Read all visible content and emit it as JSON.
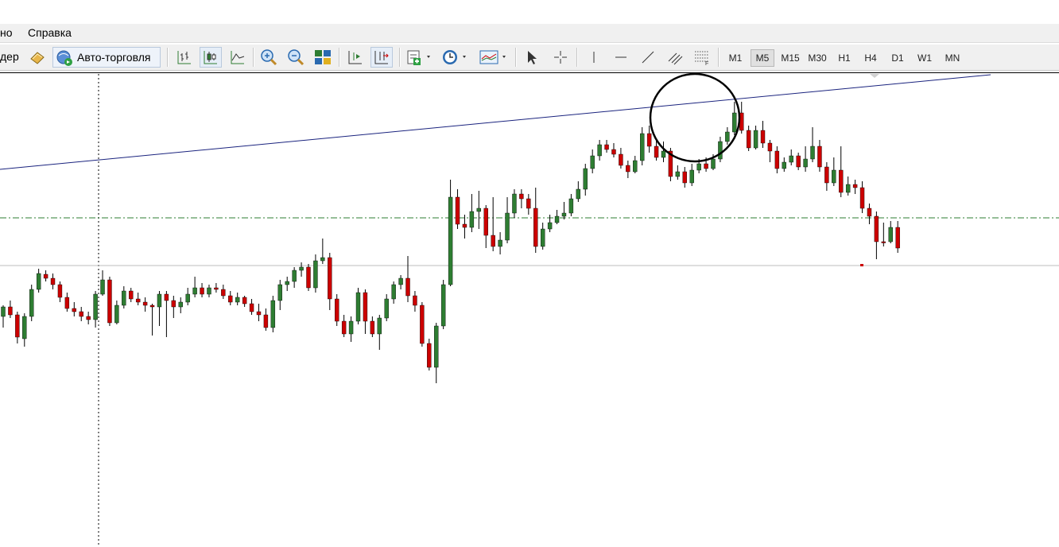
{
  "menu": {
    "item_partial": "но",
    "help": "Справка"
  },
  "toolbar": {
    "partial_label": "дер",
    "auto_trading_label": "Авто-торговля",
    "timeframes": [
      "M1",
      "M5",
      "M15",
      "M30",
      "H1",
      "H4",
      "D1",
      "W1",
      "MN"
    ],
    "active_timeframe": "M5",
    "icons": [
      "bar-chart-icon",
      "candlestick-chart-icon",
      "line-chart-icon",
      "zoom-in-icon",
      "zoom-out-icon",
      "tile-windows-icon",
      "chart-shift-icon",
      "autoscroll-icon",
      "indicators-icon",
      "periods-clock-icon",
      "templates-icon",
      "cursor-icon",
      "crosshair-icon",
      "vertical-line-icon",
      "horizontal-line-icon",
      "trendline-icon",
      "channel-icon",
      "fibonacci-icon"
    ]
  },
  "chart_data": {
    "type": "candlestick",
    "bullish_color": "#2e7d32",
    "bearish_color": "#cc0000",
    "candles": [
      [
        398,
        386,
        412,
        384
      ],
      [
        386,
        396,
        400,
        378
      ],
      [
        396,
        424,
        432,
        392
      ],
      [
        426,
        398,
        436,
        394
      ],
      [
        398,
        364,
        404,
        358
      ],
      [
        364,
        344,
        368,
        338
      ],
      [
        345,
        350,
        354,
        340
      ],
      [
        350,
        358,
        364,
        344
      ],
      [
        358,
        374,
        380,
        354
      ],
      [
        374,
        388,
        392,
        368
      ],
      [
        388,
        392,
        398,
        380
      ],
      [
        392,
        398,
        404,
        386
      ],
      [
        398,
        402,
        408,
        392
      ],
      [
        402,
        370,
        412,
        366
      ],
      [
        370,
        352,
        372,
        340
      ],
      [
        352,
        406,
        410,
        348
      ],
      [
        406,
        384,
        408,
        378
      ],
      [
        384,
        366,
        388,
        360
      ],
      [
        366,
        376,
        380,
        362
      ],
      [
        376,
        380,
        384,
        368
      ],
      [
        380,
        384,
        392,
        374
      ],
      [
        384,
        386,
        422,
        382
      ],
      [
        386,
        370,
        410,
        366
      ],
      [
        370,
        378,
        424,
        366
      ],
      [
        378,
        386,
        400,
        372
      ],
      [
        386,
        380,
        394,
        374
      ],
      [
        380,
        370,
        384,
        362
      ],
      [
        370,
        362,
        374,
        348
      ],
      [
        362,
        370,
        374,
        356
      ],
      [
        370,
        362,
        374,
        358
      ],
      [
        362,
        364,
        368,
        356
      ],
      [
        364,
        372,
        376,
        358
      ],
      [
        372,
        380,
        384,
        366
      ],
      [
        380,
        374,
        384,
        368
      ],
      [
        374,
        382,
        386,
        372
      ],
      [
        382,
        392,
        396,
        376
      ],
      [
        392,
        396,
        404,
        382
      ],
      [
        396,
        412,
        416,
        388
      ],
      [
        412,
        378,
        418,
        372
      ],
      [
        378,
        358,
        390,
        352
      ],
      [
        358,
        354,
        366,
        348
      ],
      [
        354,
        340,
        362,
        336
      ],
      [
        340,
        336,
        348,
        330
      ],
      [
        336,
        362,
        366,
        332
      ],
      [
        362,
        328,
        368,
        320
      ],
      [
        328,
        324,
        332,
        300
      ],
      [
        324,
        376,
        390,
        318
      ],
      [
        376,
        404,
        410,
        370
      ],
      [
        404,
        420,
        424,
        396
      ],
      [
        420,
        404,
        430,
        398
      ],
      [
        404,
        368,
        408,
        362
      ],
      [
        368,
        404,
        420,
        364
      ],
      [
        404,
        420,
        424,
        398
      ],
      [
        420,
        400,
        440,
        396
      ],
      [
        400,
        376,
        404,
        370
      ],
      [
        376,
        358,
        382,
        354
      ],
      [
        358,
        350,
        364,
        346
      ],
      [
        350,
        372,
        380,
        322
      ],
      [
        372,
        384,
        392,
        366
      ],
      [
        384,
        432,
        436,
        380
      ],
      [
        432,
        462,
        466,
        426
      ],
      [
        462,
        410,
        482,
        406
      ],
      [
        410,
        358,
        414,
        352
      ],
      [
        358,
        248,
        360,
        226
      ],
      [
        248,
        282,
        288,
        238
      ],
      [
        282,
        286,
        300,
        270
      ],
      [
        286,
        266,
        292,
        244
      ],
      [
        266,
        262,
        288,
        240
      ],
      [
        262,
        296,
        312,
        258
      ],
      [
        296,
        310,
        316,
        248
      ],
      [
        310,
        302,
        320,
        292
      ],
      [
        302,
        268,
        306,
        248
      ],
      [
        268,
        244,
        274,
        238
      ],
      [
        244,
        250,
        262,
        238
      ],
      [
        250,
        262,
        270,
        244
      ],
      [
        262,
        310,
        318,
        236
      ],
      [
        310,
        288,
        314,
        280
      ],
      [
        288,
        280,
        292,
        270
      ],
      [
        280,
        272,
        282,
        264
      ],
      [
        272,
        268,
        276,
        254
      ],
      [
        268,
        250,
        272,
        244
      ],
      [
        250,
        238,
        254,
        228
      ],
      [
        238,
        212,
        246,
        206
      ],
      [
        212,
        196,
        218,
        188
      ],
      [
        196,
        182,
        202,
        176
      ],
      [
        182,
        188,
        192,
        176
      ],
      [
        188,
        194,
        198,
        180
      ],
      [
        194,
        208,
        212,
        186
      ],
      [
        208,
        216,
        224,
        202
      ],
      [
        216,
        202,
        218,
        196
      ],
      [
        202,
        168,
        208,
        160
      ],
      [
        168,
        184,
        192,
        158
      ],
      [
        184,
        198,
        202,
        174
      ],
      [
        198,
        190,
        204,
        178
      ],
      [
        190,
        222,
        228,
        186
      ],
      [
        222,
        216,
        226,
        208
      ],
      [
        216,
        230,
        236,
        210
      ],
      [
        230,
        214,
        234,
        206
      ],
      [
        214,
        206,
        218,
        200
      ],
      [
        206,
        212,
        216,
        198
      ],
      [
        212,
        200,
        214,
        194
      ],
      [
        200,
        178,
        204,
        172
      ],
      [
        178,
        166,
        182,
        160
      ],
      [
        166,
        142,
        170,
        128
      ],
      [
        142,
        164,
        168,
        128
      ],
      [
        164,
        186,
        190,
        158
      ],
      [
        186,
        164,
        188,
        158
      ],
      [
        164,
        180,
        186,
        152
      ],
      [
        180,
        190,
        204,
        176
      ],
      [
        190,
        212,
        218,
        184
      ],
      [
        212,
        204,
        216,
        198
      ],
      [
        204,
        196,
        208,
        188
      ],
      [
        196,
        210,
        214,
        192
      ],
      [
        210,
        200,
        216,
        184
      ],
      [
        200,
        184,
        204,
        160
      ],
      [
        184,
        210,
        216,
        176
      ],
      [
        210,
        230,
        240,
        204
      ],
      [
        230,
        214,
        234,
        198
      ],
      [
        214,
        242,
        248,
        184
      ],
      [
        242,
        232,
        246,
        222
      ],
      [
        232,
        236,
        244,
        226
      ],
      [
        236,
        262,
        268,
        228
      ],
      [
        262,
        272,
        282,
        256
      ],
      [
        272,
        304,
        326,
        266
      ],
      [
        304,
        304,
        310,
        280
      ],
      [
        304,
        286,
        306,
        278
      ],
      [
        286,
        312,
        318,
        278
      ]
    ],
    "trendline_start_price": 1.0,
    "horizontal_levels": [
      "dash-dot green level",
      "solid grey current price level"
    ],
    "annotation": "circle"
  }
}
